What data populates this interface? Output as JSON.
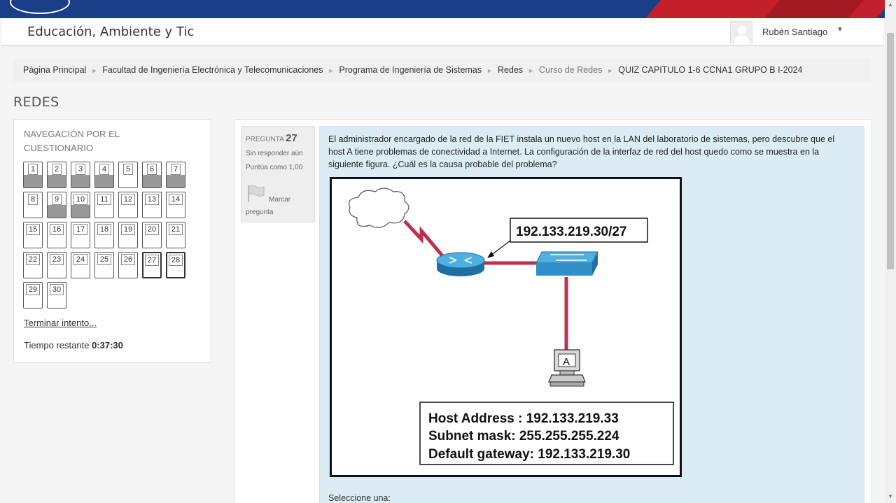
{
  "site": {
    "title": "Educación, Ambiente y Tic"
  },
  "user": {
    "name": "Rubén Santiago",
    "menu_caret": "▼"
  },
  "breadcrumb": [
    {
      "label": "Página Principal"
    },
    {
      "label": "Facultad de Ingeniería Electrónica y Telecomunicaciones"
    },
    {
      "label": "Programa de Ingeniería de Sistemas"
    },
    {
      "label": "Redes"
    },
    {
      "label": "Curso de Redes"
    },
    {
      "label": "QUIZ CAPITULO 1-6 CCNA1 GRUPO B I-2024"
    }
  ],
  "breadcrumb_separator": "►",
  "page_title": "REDES",
  "quiz_nav": {
    "title": "NAVEGACIÓN POR EL CUESTIONARIO",
    "questions": [
      {
        "n": "1",
        "answered": true
      },
      {
        "n": "2",
        "answered": true
      },
      {
        "n": "3",
        "answered": true
      },
      {
        "n": "4",
        "answered": true
      },
      {
        "n": "5",
        "answered": false
      },
      {
        "n": "6",
        "answered": true
      },
      {
        "n": "7",
        "answered": true
      },
      {
        "n": "8",
        "answered": false
      },
      {
        "n": "9",
        "answered": true
      },
      {
        "n": "10",
        "answered": true
      },
      {
        "n": "11",
        "answered": false
      },
      {
        "n": "12",
        "answered": false
      },
      {
        "n": "13",
        "answered": false
      },
      {
        "n": "14",
        "answered": false
      },
      {
        "n": "15",
        "answered": false
      },
      {
        "n": "16",
        "answered": false
      },
      {
        "n": "17",
        "answered": false
      },
      {
        "n": "18",
        "answered": false
      },
      {
        "n": "19",
        "answered": false
      },
      {
        "n": "20",
        "answered": false
      },
      {
        "n": "21",
        "answered": false
      },
      {
        "n": "22",
        "answered": false
      },
      {
        "n": "23",
        "answered": false
      },
      {
        "n": "24",
        "answered": false
      },
      {
        "n": "25",
        "answered": false
      },
      {
        "n": "26",
        "answered": false
      },
      {
        "n": "27",
        "answered": false,
        "current": true
      },
      {
        "n": "28",
        "answered": false,
        "current": true
      },
      {
        "n": "29",
        "answered": false
      },
      {
        "n": "30",
        "answered": false
      }
    ],
    "finish_label": "Terminar intento...",
    "timer_label": "Tiempo restante",
    "timer_value": "0:37:30"
  },
  "question": {
    "label": "PREGUNTA",
    "number": "27",
    "state": "Sin responder aún",
    "grade": "Puntúa como 1,00",
    "flag_label": "Marcar pregunta",
    "text": "El administrador encargado de la red de la FIET instala un nuevo host en la LAN del laboratorio de sistemas, pero descubre que el host A tiene problemas de conectividad a Internet. La configuración de la interfaz de red del host quedo como se muestra en la siguiente figura. ¿Cuál es la causa probable del problema?",
    "select_label": "Seleccione una:"
  },
  "figure": {
    "router_ip": "192.133.219.30/27",
    "host_label": "A",
    "host_address": "Host Address : 192.133.219.33",
    "subnet_mask": "Subnet mask: 255.255.255.224",
    "default_gateway": "Default gateway: 192.133.219.30"
  },
  "colors": {
    "banner": "#1b3f86",
    "accent_red": "#c4202b",
    "question_bg": "#dcecf5",
    "link_red": "#c0304a",
    "device_blue": "#2f8fc8"
  }
}
